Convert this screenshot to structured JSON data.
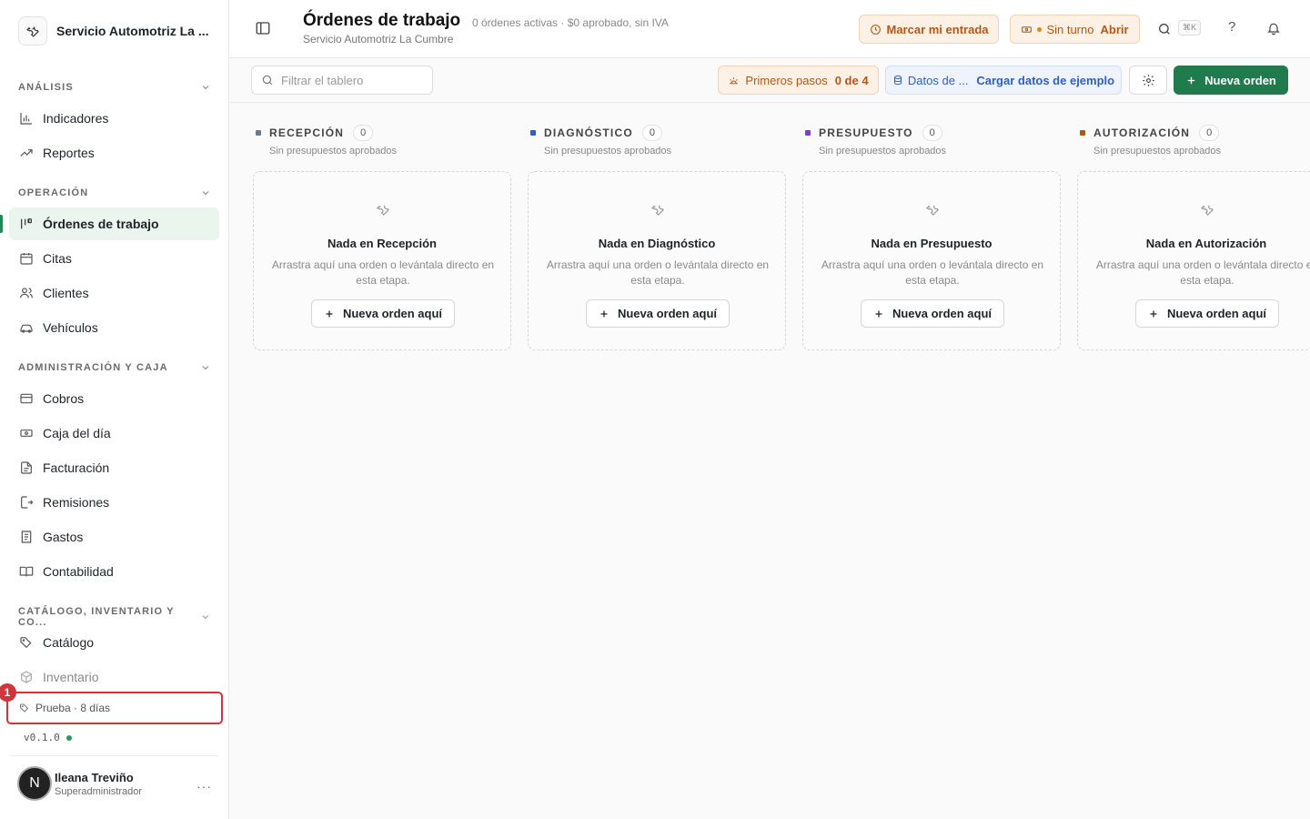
{
  "sidebar": {
    "brand_name": "Servicio Automotriz La ...",
    "sections": {
      "analisis": "ANÁLISIS",
      "operacion": "OPERACIÓN",
      "admin": "ADMINISTRACIÓN Y CAJA",
      "catalogo": "CATÁLOGO, INVENTARIO Y CO..."
    },
    "items": {
      "indicadores": "Indicadores",
      "reportes": "Reportes",
      "ordenes": "Órdenes de trabajo",
      "citas": "Citas",
      "clientes": "Clientes",
      "vehiculos": "Vehículos",
      "cobros": "Cobros",
      "caja": "Caja del día",
      "facturacion": "Facturación",
      "remisiones": "Remisiones",
      "gastos": "Gastos",
      "contabilidad": "Contabilidad",
      "catalogo": "Catálogo",
      "inventario": "Inventario"
    },
    "trial_label": "Prueba · 8 días",
    "annotation_number": "1",
    "version": "v0.1.0",
    "user": {
      "initial": "N",
      "name": "Ileana Treviño",
      "role": "Superadministrador",
      "menu": "···"
    }
  },
  "topbar": {
    "title": "Órdenes de trabajo",
    "subtitle": "Servicio Automotriz La Cumbre",
    "meta": "0 órdenes activas · $0 aprobado, sin IVA",
    "entry_button": "Marcar mi entrada",
    "shift_status": "Sin turno",
    "shift_action": "Abrir",
    "shortcut": "⌘K",
    "help": "?"
  },
  "toolbar": {
    "filter_placeholder": "Filtrar el tablero",
    "steps_label": "Primeros pasos",
    "steps_progress": "0 de 4",
    "sample_label": "Datos de ...",
    "sample_action": "Cargar datos de ejemplo",
    "new_order": "Nueva orden"
  },
  "board": {
    "columns": [
      {
        "title": "RECEPCIÓN",
        "count": "0",
        "subtitle": "Sin presupuestos aprobados",
        "empty_title": "Nada en Recepción",
        "empty_desc": "Arrastra aquí una orden o levántala directo en esta etapa.",
        "button": "Nueva orden aquí",
        "color": "#6b7a8f"
      },
      {
        "title": "DIAGNÓSTICO",
        "count": "0",
        "subtitle": "Sin presupuestos aprobados",
        "empty_title": "Nada en Diagnóstico",
        "empty_desc": "Arrastra aquí una orden o levántala directo en esta etapa.",
        "button": "Nueva orden aquí",
        "color": "#2f5fc4"
      },
      {
        "title": "PRESUPUESTO",
        "count": "0",
        "subtitle": "Sin presupuestos aprobados",
        "empty_title": "Nada en Presupuesto",
        "empty_desc": "Arrastra aquí una orden o levántala directo en esta etapa.",
        "button": "Nueva orden aquí",
        "color": "#7a3fd1"
      },
      {
        "title": "AUTORIZACIÓN",
        "count": "0",
        "subtitle": "Sin presupuestos aprobados",
        "empty_title": "Nada en Autorización",
        "empty_desc": "Arrastra aquí una orden o levántala directo en esta etapa.",
        "button": "Nueva orden aquí",
        "color": "#b4581a"
      }
    ]
  }
}
